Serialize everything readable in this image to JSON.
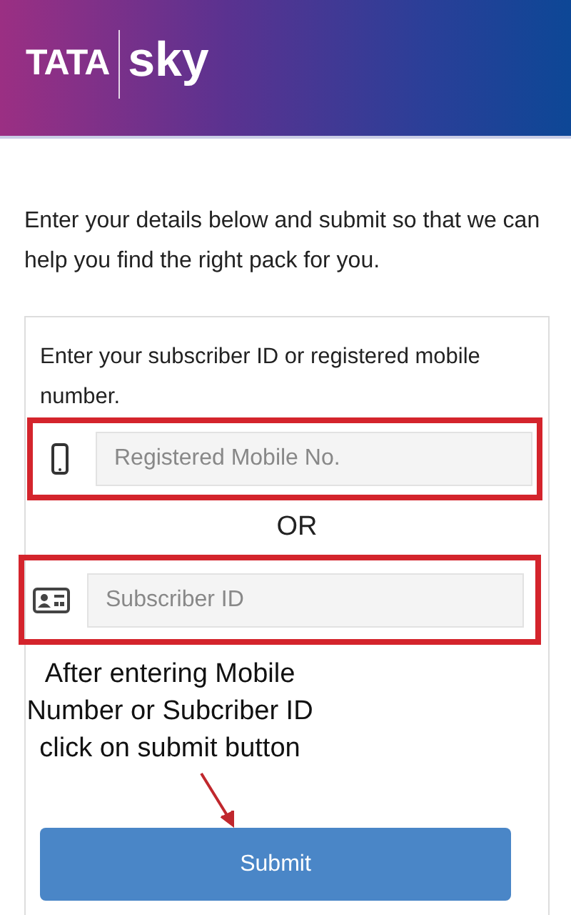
{
  "header": {
    "brand": "TATA",
    "product": "sky"
  },
  "intro": "Enter your details below and submit so that we can help you find the right pack for you.",
  "form": {
    "prompt": "Enter your subscriber ID or registered mobile number.",
    "fields": [
      {
        "kind": "mobile",
        "placeholder": "Registered Mobile No.",
        "highlighted": true
      },
      {
        "kind": "subscriber",
        "placeholder": "Subscriber ID",
        "highlighted": true
      }
    ],
    "separator": "OR",
    "annotation": "After entering Mobile Number or Subcriber ID click on submit button",
    "submit": "Submit"
  }
}
